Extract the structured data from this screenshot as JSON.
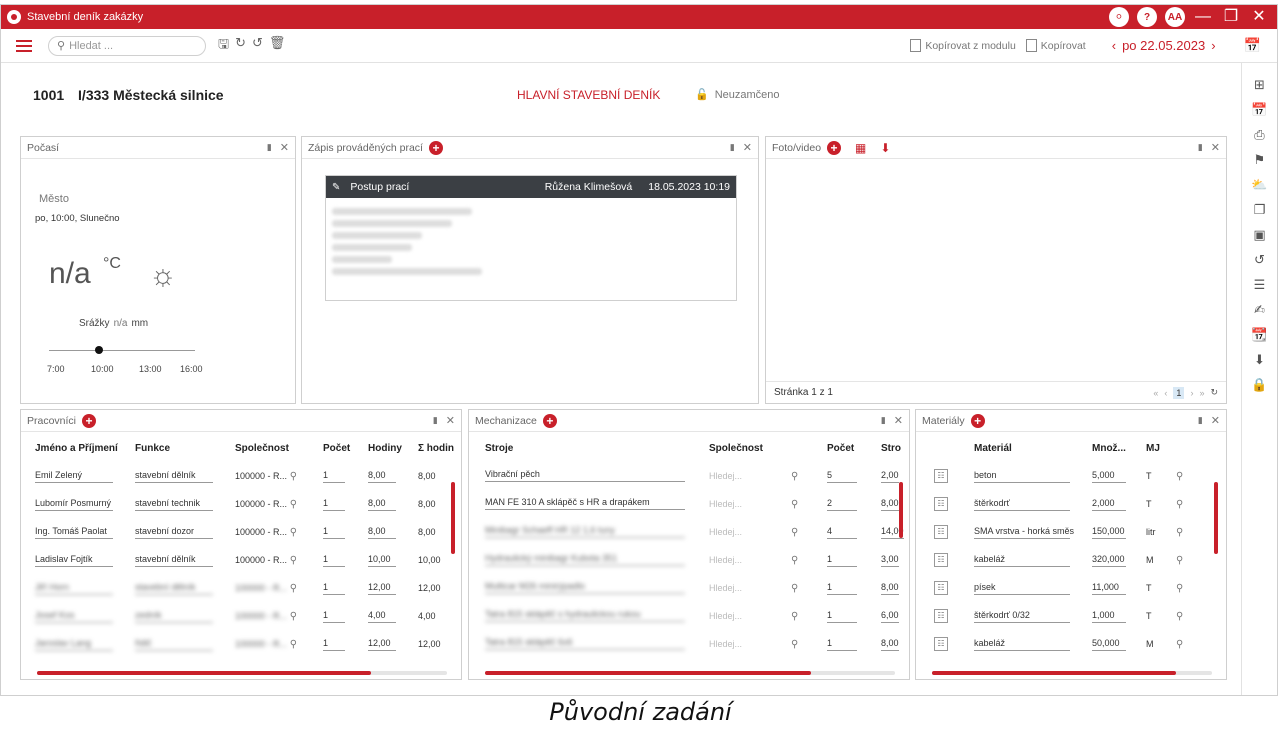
{
  "window": {
    "title": "Stavební deník zakázky",
    "avatar": "AA",
    "help": "?",
    "bell": "🔔"
  },
  "toolbar": {
    "search_placeholder": "Hledat ...",
    "copy_from_module": "Kopírovat z modulu",
    "copy": "Kopírovat",
    "date": "po 22.05.2023"
  },
  "header": {
    "project_number": "1001",
    "project_name": "I/333 Městecká silnice",
    "diary_type": "HLAVNÍ STAVEBNÍ DENÍK",
    "lock_status": "Neuzamčeno"
  },
  "weather": {
    "title": "Počasí",
    "city_label": "Město",
    "day_info": "po, 10:00, Slunečno",
    "temperature": "n/a",
    "unit": "°C",
    "precip_label": "Srážky",
    "precip_value": "n/a",
    "precip_unit": "mm",
    "ticks": [
      "7:00",
      "10:00",
      "13:00",
      "16:00"
    ]
  },
  "zapis": {
    "title": "Zápis prováděných prací",
    "entry_title": "Postup prací",
    "entry_author": "Růžena Klimešová",
    "entry_datetime": "18.05.2023 10:19"
  },
  "foto": {
    "title": "Foto/video",
    "page_info": "Stránka 1 z 1",
    "current_page": "1"
  },
  "pracovnici": {
    "title": "Pracovníci",
    "columns": [
      "Jméno a Příjmení",
      "Funkce",
      "Společnost",
      "Počet",
      "Hodiny",
      "Σ hodin"
    ],
    "rows": [
      {
        "name": "Emil Zelený",
        "role": "stavební dělník",
        "company": "100000 - R...",
        "count": "1",
        "hours": "8,00",
        "sum": "8,00"
      },
      {
        "name": "Lubomír Posmurný",
        "role": "stavební technik",
        "company": "100000 - R...",
        "count": "1",
        "hours": "8,00",
        "sum": "8,00"
      },
      {
        "name": "Ing. Tomáš Paolat",
        "role": "stavební dozor",
        "company": "100000 - R...",
        "count": "1",
        "hours": "8,00",
        "sum": "8,00"
      },
      {
        "name": "Ladislav Fojtík",
        "role": "stavební dělník",
        "company": "100000 - R...",
        "count": "1",
        "hours": "10,00",
        "sum": "10,00"
      },
      {
        "name": "Jiří Horn",
        "role": "stavební dělník",
        "company": "100000 - R...",
        "count": "1",
        "hours": "12,00",
        "sum": "12,00"
      },
      {
        "name": "Josef Kos",
        "role": "zedník",
        "company": "100000 - R...",
        "count": "1",
        "hours": "4,00",
        "sum": "4,00"
      },
      {
        "name": "Jaroslav Lang",
        "role": "řidič",
        "company": "100000 - R...",
        "count": "1",
        "hours": "12,00",
        "sum": "12,00"
      }
    ]
  },
  "mechanizace": {
    "title": "Mechanizace",
    "columns": [
      "Stroje",
      "Společnost",
      "Počet",
      "Stro"
    ],
    "search_hint": "Hledej...",
    "rows": [
      {
        "machine": "Vibrační pěch",
        "count": "5",
        "value": "2,00"
      },
      {
        "machine": "MAN FE 310 A sklápěč s HR a drapákem",
        "count": "2",
        "value": "8,00"
      },
      {
        "machine": "Minibagr Schaeff HR 12 1,6 tuny",
        "count": "4",
        "value": "14,00"
      },
      {
        "machine": "Hydraulický minibagr Kubota 351",
        "count": "1",
        "value": "3,00"
      },
      {
        "machine": "Multicar M26 minirýpadlo",
        "count": "1",
        "value": "8,00"
      },
      {
        "machine": "Tatra 815 sklápěč s hydraulickou rukou",
        "count": "1",
        "value": "6,00"
      },
      {
        "machine": "Tatra 815 sklápěč 6x6",
        "count": "1",
        "value": "8,00"
      }
    ]
  },
  "materialy": {
    "title": "Materiály",
    "columns": [
      "Materiál",
      "Množ...",
      "MJ"
    ],
    "rows": [
      {
        "material": "beton",
        "qty": "5,000",
        "unit": "T"
      },
      {
        "material": "štěrkodrť",
        "qty": "2,000",
        "unit": "T"
      },
      {
        "material": "SMA vrstva - horká směs",
        "qty": "150,000",
        "unit": "litr"
      },
      {
        "material": "kabeláž",
        "qty": "320,000",
        "unit": "M"
      },
      {
        "material": "písek",
        "qty": "11,000",
        "unit": "T"
      },
      {
        "material": "štěrkodrť 0/32",
        "qty": "1,000",
        "unit": "T"
      },
      {
        "material": "kabeláž",
        "qty": "50,000",
        "unit": "M"
      }
    ]
  },
  "caption": "Původní zadání",
  "colors": {
    "accent": "#c8202a",
    "dark_header": "#3b3f44"
  }
}
